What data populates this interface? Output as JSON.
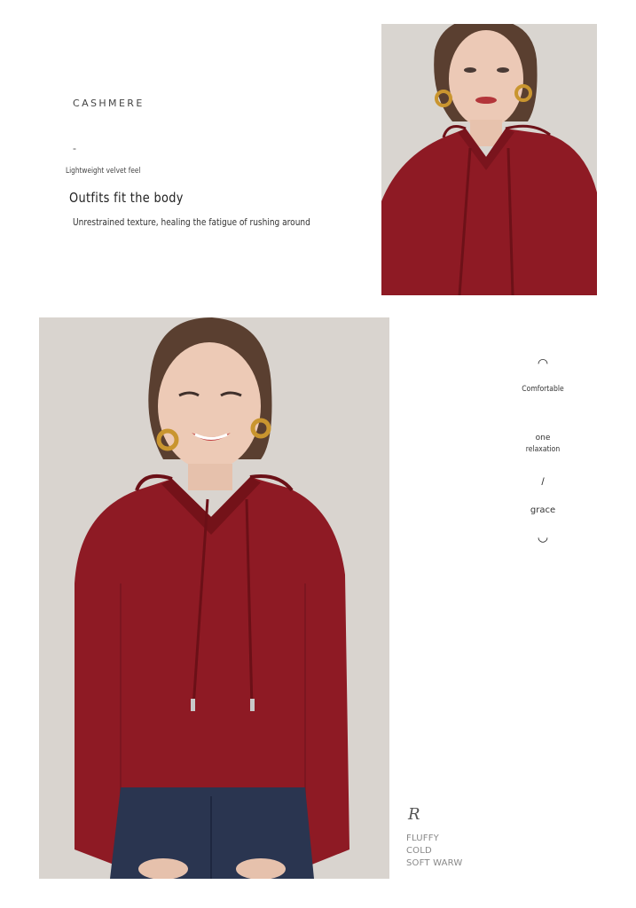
{
  "intro": {
    "brand": "CASHMERE",
    "dash": "-",
    "velvet": "Lightweight velvet feel",
    "headline": "Outfits fit the body",
    "subline": "Unrestrained texture, healing the fatigue of rushing around"
  },
  "side_words": {
    "open_arc": "◠",
    "comfortable": "Comfortable",
    "one": "one",
    "relaxation": "relaxation",
    "slash": "/",
    "grace": "grace",
    "close_arc": "◡"
  },
  "tags": {
    "script_mark": "R",
    "line1": "FLUFFY",
    "line2": "COLD",
    "line3": "SOFT WARW"
  },
  "colors": {
    "sweater": "#8e1a24",
    "background": "#d8d3ce",
    "jeans": "#2a3550"
  }
}
